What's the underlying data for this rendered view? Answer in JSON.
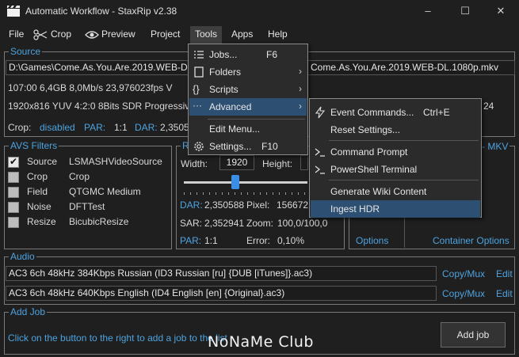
{
  "window": {
    "title": "Automatic Workflow - StaxRip v2.38",
    "minimize": "–",
    "maximize": "☐",
    "close": "✕"
  },
  "menubar": {
    "items": [
      "File",
      "Crop",
      "Preview",
      "Project",
      "Tools",
      "Apps",
      "Help"
    ],
    "crop_icon": "scissors-icon",
    "preview_icon": "eye-icon"
  },
  "source": {
    "label": "Source",
    "path_left": "D:\\Games\\Come.As.You.Are.2019.WEB-DL.",
    "path_right": "Come.As.You.Are.2019.WEB-DL.1080p.mkv",
    "info_line1": "107:00   6,4GB   8,0Mb/s   23,976023fps   V",
    "info_line2": "1920x816  YUV  4:2:0  8Bits  SDR  Progressive",
    "info_line2_tail": "24",
    "crop_label": "Crop:",
    "crop_value": "disabled",
    "par_label": "PAR:",
    "par_value": "1:1",
    "dar_label": "DAR:",
    "dar_value": "2,3505"
  },
  "avs_filters": {
    "label": "AVS Filters",
    "rows": [
      {
        "name": "Source",
        "value": "LSMASHVideoSource",
        "checked": true
      },
      {
        "name": "Crop",
        "value": "Crop",
        "checked": false
      },
      {
        "name": "Field",
        "value": "QTGMC Medium",
        "checked": false
      },
      {
        "name": "Noise",
        "value": "DFTTest",
        "checked": false
      },
      {
        "name": "Resize",
        "value": "BicubicResize",
        "checked": false
      }
    ]
  },
  "resize": {
    "label": "R",
    "width_label": "Width:",
    "width_value": "1920",
    "height_label": "Height:",
    "slider_pct": 30,
    "dar_label": "DAR:",
    "dar_value": "2,350588",
    "pixel_label": "Pixel:",
    "pixel_value": "156672",
    "sar_label": "SAR:",
    "sar_value": "2,352941",
    "zoom_label": "Zoom:",
    "zoom_value": "100,0/100,0",
    "par_label": "PAR:",
    "par_value": "1:1",
    "error_label": "Error:",
    "error_value": "0,10%"
  },
  "container": {
    "label_tail": "- MKV",
    "options_label": "Options",
    "container_options_label": "Container Options"
  },
  "audio": {
    "label": "Audio",
    "tracks": [
      {
        "text": "AC3 6ch 48kHz 384Kbps Russian (ID3 Russian [ru] {DUB [iTunes]}.ac3)",
        "copy_label": "Copy/Mux",
        "edit_label": "Edit"
      },
      {
        "text": "AC3 6ch 48kHz 640Kbps English (ID4 English [en] {Original}.ac3)",
        "copy_label": "Copy/Mux",
        "edit_label": "Edit"
      }
    ]
  },
  "add_job": {
    "label": "Add Job",
    "hint": "Click on the button to the right to add a job to the list",
    "button": "Add job"
  },
  "tools_menu": {
    "items": [
      {
        "label": "Jobs...",
        "shortcut": "F6",
        "icon": "list-icon"
      },
      {
        "label": "Folders",
        "arrow": "›",
        "icon": "folder-icon"
      },
      {
        "label": "Scripts",
        "arrow": "›",
        "icon": "braces-icon"
      },
      {
        "label": "Advanced",
        "arrow": "›",
        "icon": "ellipsis-icon"
      },
      {
        "label": "Edit Menu...",
        "icon": ""
      },
      {
        "label": "Settings...",
        "shortcut": "F10",
        "icon": "gear-icon"
      }
    ]
  },
  "advanced_menu": {
    "items": [
      {
        "label": "Event Commands...",
        "shortcut": "Ctrl+E",
        "icon": "lightning-icon"
      },
      {
        "label": "Reset Settings...",
        "icon": ""
      },
      {
        "label": "Command Prompt",
        "icon": "terminal-icon"
      },
      {
        "label": "PowerShell Terminal",
        "icon": "terminal-icon"
      },
      {
        "label": "Generate Wiki Content",
        "icon": ""
      },
      {
        "label": "Ingest HDR",
        "icon": ""
      }
    ]
  },
  "watermark": "NoNaMe Club",
  "colors": {
    "accent": "#4da3e0",
    "highlight": "#2c4f72",
    "background": "#1f1f1f"
  }
}
